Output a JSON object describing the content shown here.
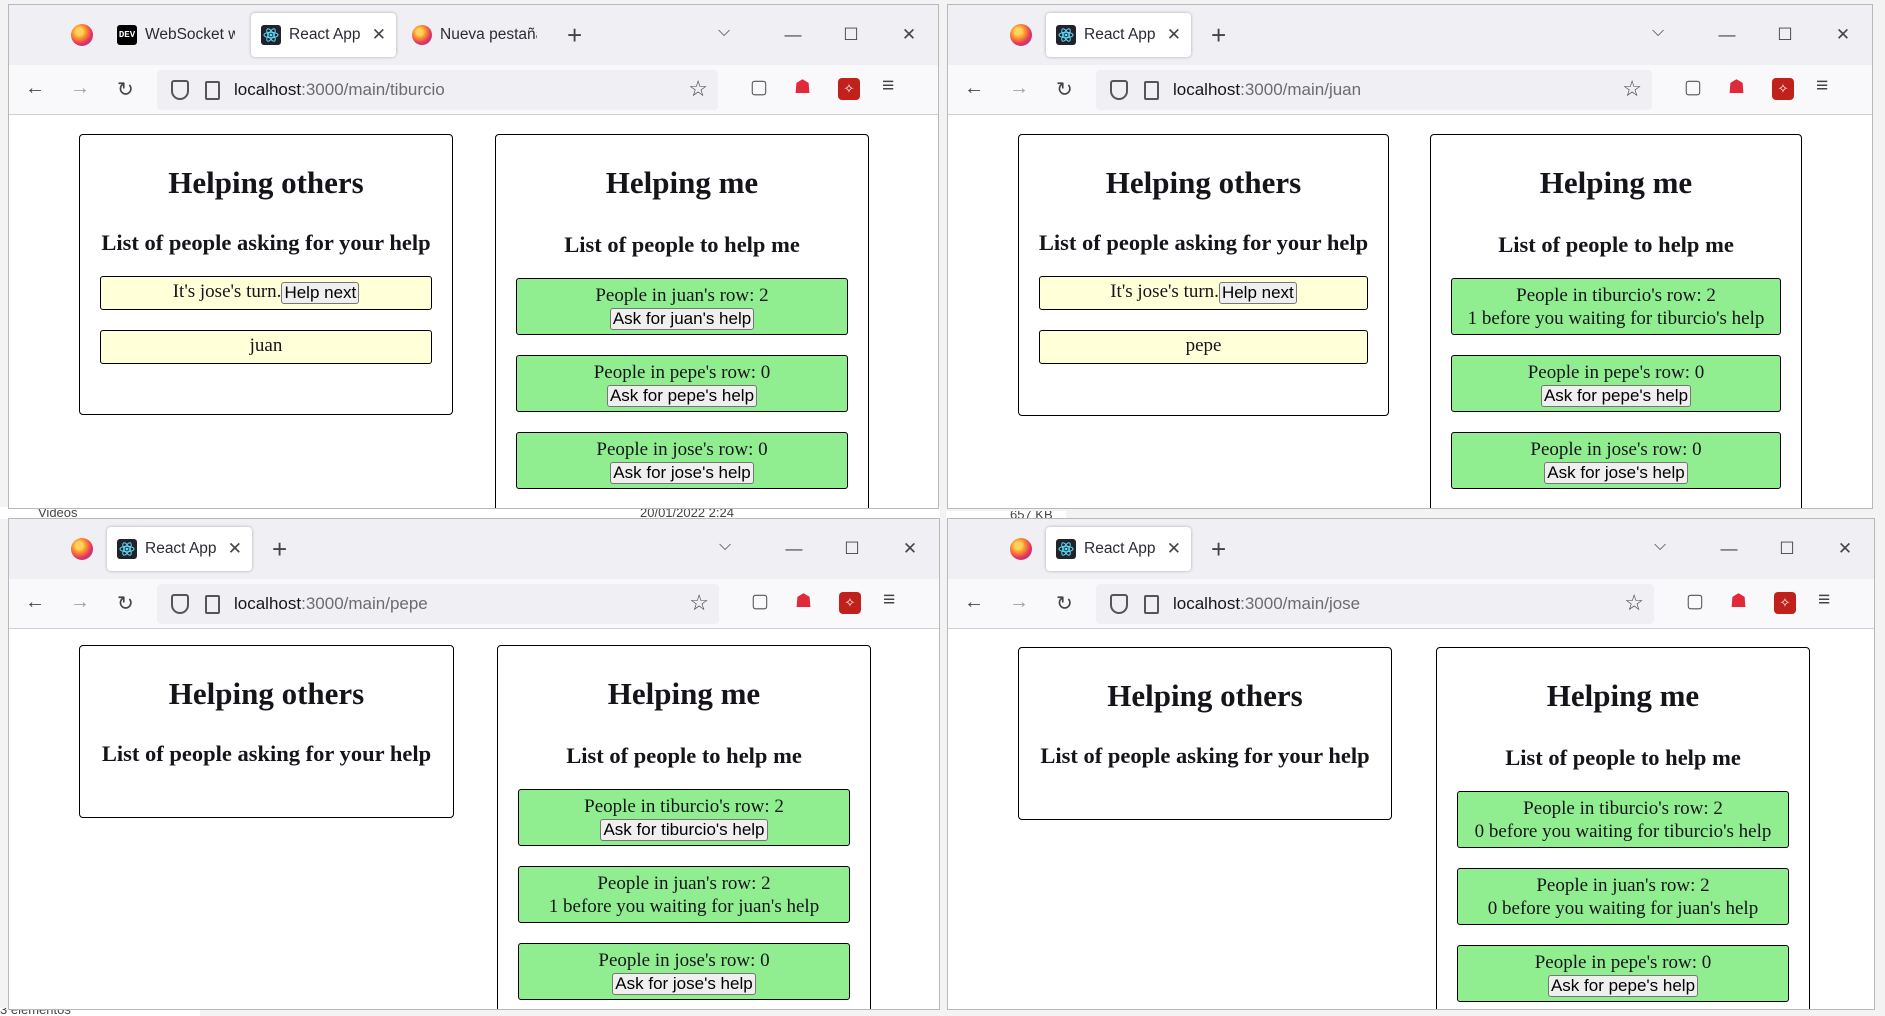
{
  "background": {
    "sidebar_item": "Videos",
    "status_text": "3 elementos",
    "size_text": "657 KB",
    "date_text": "20/01/2022 2:24"
  },
  "windows": [
    {
      "id": "tiburcio",
      "tabs": [
        {
          "title": "WebSocket with",
          "favicon": "dev-icon",
          "active": false,
          "closable": false
        },
        {
          "title": "React App",
          "favicon": "react-icon",
          "active": true,
          "closable": true
        },
        {
          "title": "Nueva pestaña",
          "favicon": "firefox-icon",
          "active": false,
          "closable": false
        }
      ],
      "url_host": "localhost",
      "url_path": ":3000/main/tiburcio",
      "helping_others": {
        "title": "Helping others",
        "subtitle": "List of people asking for your help",
        "turn_text": "It's jose's turn.",
        "help_next_label": "Help next",
        "queue": [
          "juan"
        ]
      },
      "helping_me": {
        "title": "Helping me",
        "subtitle": "List of people to help me",
        "rows": [
          {
            "text": "People in juan's row: 2",
            "button": "Ask for juan's help"
          },
          {
            "text": "People in pepe's row: 0",
            "button": "Ask for pepe's help"
          },
          {
            "text": "People in jose's row: 0",
            "button": "Ask for jose's help"
          }
        ]
      }
    },
    {
      "id": "juan",
      "tabs": [
        {
          "title": "React App",
          "favicon": "react-icon",
          "active": true,
          "closable": true
        }
      ],
      "url_host": "localhost",
      "url_path": ":3000/main/juan",
      "helping_others": {
        "title": "Helping others",
        "subtitle": "List of people asking for your help",
        "turn_text": "It's jose's turn.",
        "help_next_label": "Help next",
        "queue": [
          "pepe"
        ]
      },
      "helping_me": {
        "title": "Helping me",
        "subtitle": "List of people to help me",
        "rows": [
          {
            "text": "People in tiburcio's row: 2",
            "status": "1 before you waiting for tiburcio's help"
          },
          {
            "text": "People in pepe's row: 0",
            "button": "Ask for pepe's help"
          },
          {
            "text": "People in jose's row: 0",
            "button": "Ask for jose's help"
          }
        ]
      }
    },
    {
      "id": "pepe",
      "tabs": [
        {
          "title": "React App",
          "favicon": "react-icon",
          "active": true,
          "closable": true
        }
      ],
      "url_host": "localhost",
      "url_path": ":3000/main/pepe",
      "helping_others": {
        "title": "Helping others",
        "subtitle": "List of people asking for your help"
      },
      "helping_me": {
        "title": "Helping me",
        "subtitle": "List of people to help me",
        "rows": [
          {
            "text": "People in tiburcio's row: 2",
            "button": "Ask for tiburcio's help"
          },
          {
            "text": "People in juan's row: 2",
            "status": "1 before you waiting for juan's help"
          },
          {
            "text": "People in jose's row: 0",
            "button": "Ask for jose's help"
          }
        ]
      }
    },
    {
      "id": "jose",
      "tabs": [
        {
          "title": "React App",
          "favicon": "react-icon",
          "active": true,
          "closable": true
        }
      ],
      "url_host": "localhost",
      "url_path": ":3000/main/jose",
      "helping_others": {
        "title": "Helping others",
        "subtitle": "List of people asking for your help"
      },
      "helping_me": {
        "title": "Helping me",
        "subtitle": "List of people to help me",
        "rows": [
          {
            "text": "People in tiburcio's row: 2",
            "status": "0 before you waiting for tiburcio's help"
          },
          {
            "text": "People in juan's row: 2",
            "status": "0 before you waiting for juan's help"
          },
          {
            "text": "People in pepe's row: 0",
            "button": "Ask for pepe's help"
          }
        ]
      }
    }
  ],
  "icons": {
    "back": "←",
    "forward": "→",
    "reload": "↻",
    "star": "☆",
    "menu": "≡",
    "minimize": "—",
    "maximize": "☐",
    "close": "✕",
    "newtab": "+",
    "tablist": "⌵"
  },
  "colors": {
    "green_row": "#90ee90",
    "yellow_row": "#ffffd8"
  }
}
